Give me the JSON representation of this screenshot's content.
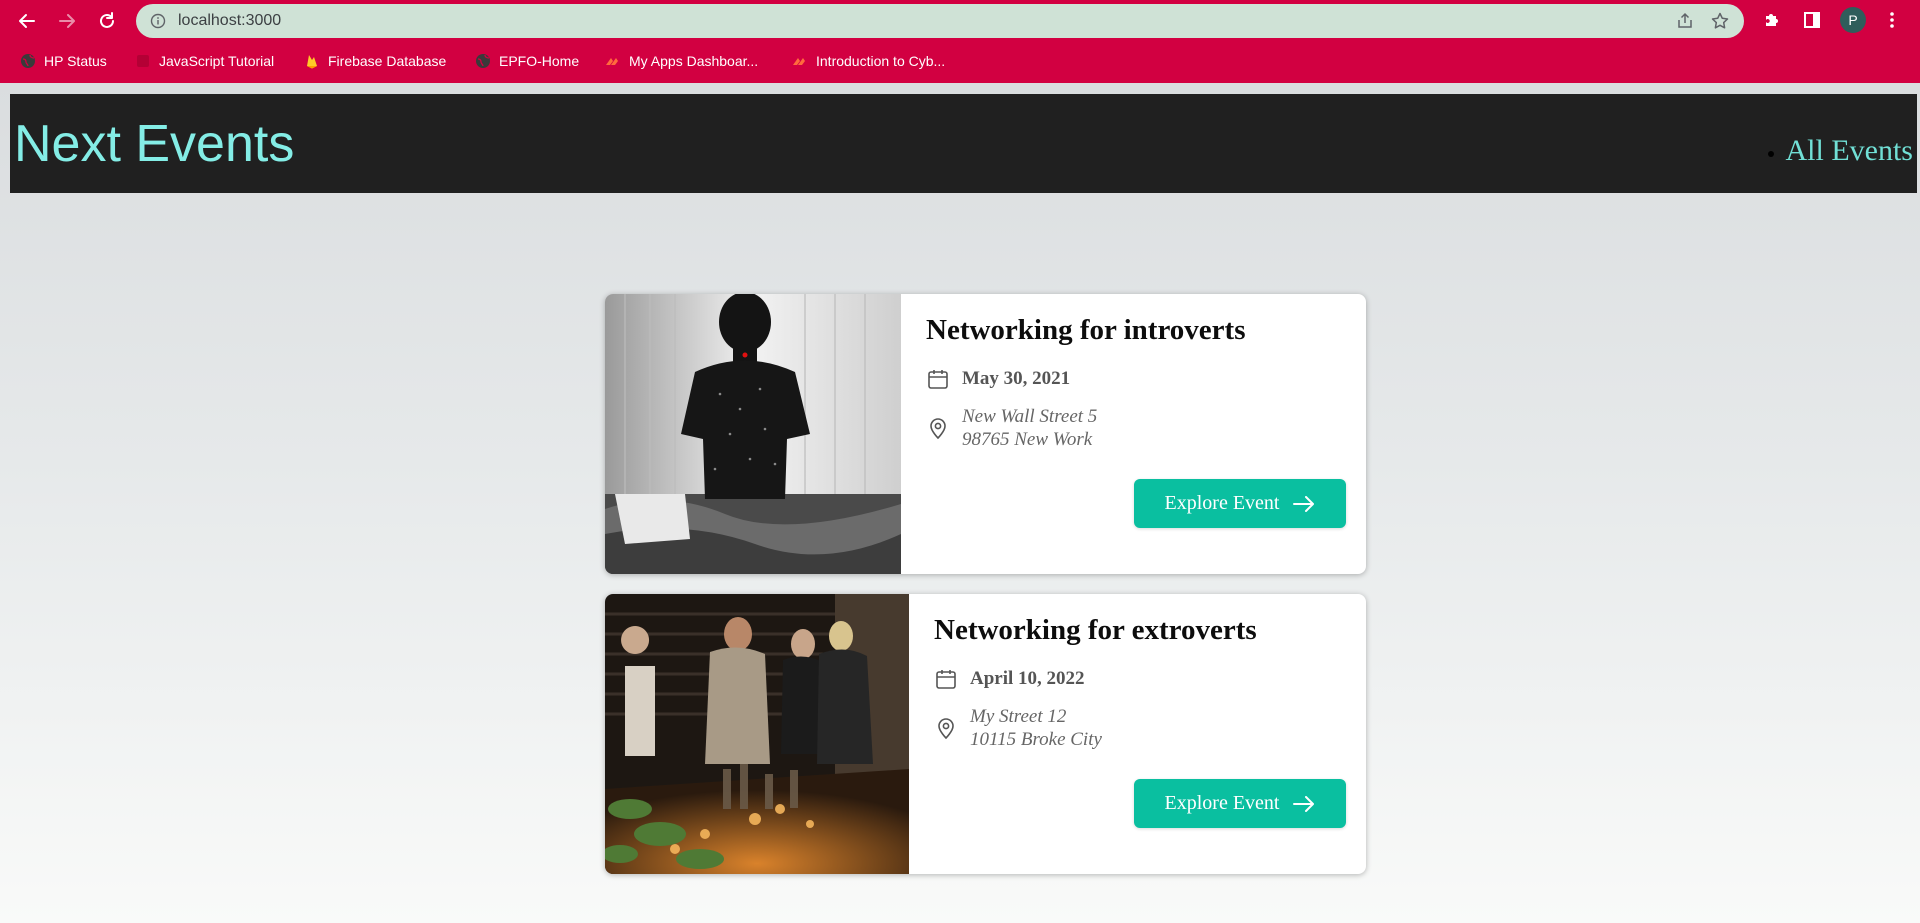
{
  "browser": {
    "url": "localhost:3000",
    "avatar_letter": "P",
    "bookmarks": [
      {
        "label": "HP Status",
        "icon": "globe-icon"
      },
      {
        "label": "JavaScript Tutorial",
        "icon": "w3-icon"
      },
      {
        "label": "Firebase Database",
        "icon": "firebase-icon"
      },
      {
        "label": "EPFO-Home",
        "icon": "globe-icon"
      },
      {
        "label": "My Apps Dashboar...",
        "icon": "apps-icon"
      },
      {
        "label": "Introduction to Cyb...",
        "icon": "apps-icon"
      }
    ],
    "colors": {
      "chrome": "#d20041",
      "omnibox": "#cfe2d6"
    }
  },
  "header": {
    "title": "Next Events",
    "nav_link": "All Events"
  },
  "events": [
    {
      "title": "Networking for introverts",
      "date": "May 30, 2021",
      "address_line1": "New Wall Street 5",
      "address_line2": "98765 New Work",
      "button_label": "Explore Event",
      "image": "person-sitting-on-bed-photo"
    },
    {
      "title": "Networking for extroverts",
      "date": "April 10, 2022",
      "address_line1": "My Street 12",
      "address_line2": "10115 Broke City",
      "button_label": "Explore Event",
      "image": "people-talking-at-bar-photo"
    }
  ],
  "colors": {
    "header_bg": "#202020",
    "title": "#84ede6",
    "nav_link": "#71e0d6",
    "button": "#0abfa0"
  }
}
